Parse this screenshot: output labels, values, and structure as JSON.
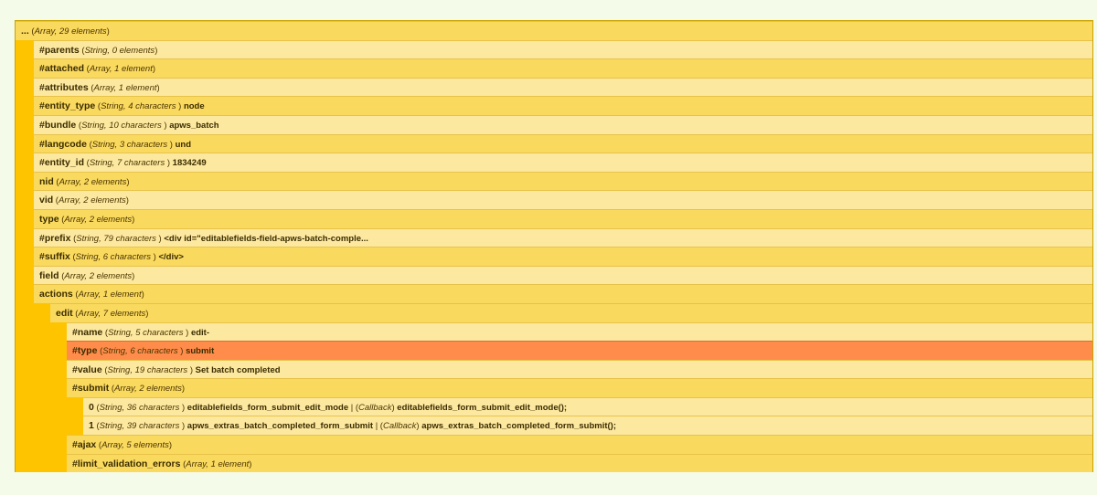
{
  "root": {
    "key": "...",
    "type": "Array",
    "size": "29 elements"
  },
  "rows": [
    {
      "key": "#parents",
      "type": "String",
      "size": "0 elements",
      "isArray": true,
      "depth": 1,
      "shade": "light"
    },
    {
      "key": "#attached",
      "type": "Array",
      "size": "1 element",
      "isArray": true,
      "depth": 1,
      "shade": "dark"
    },
    {
      "key": "#attributes",
      "type": "Array",
      "size": "1 element",
      "isArray": true,
      "depth": 1,
      "shade": "light"
    },
    {
      "key": "#entity_type",
      "type": "String",
      "size": "4 characters",
      "value": "node",
      "depth": 1,
      "shade": "dark"
    },
    {
      "key": "#bundle",
      "type": "String",
      "size": "10 characters",
      "value": "apws_batch",
      "depth": 1,
      "shade": "light"
    },
    {
      "key": "#langcode",
      "type": "String",
      "size": "3 characters",
      "value": "und",
      "depth": 1,
      "shade": "dark"
    },
    {
      "key": "#entity_id",
      "type": "String",
      "size": "7 characters",
      "value": "1834249",
      "depth": 1,
      "shade": "light"
    },
    {
      "key": "nid",
      "type": "Array",
      "size": "2 elements",
      "isArray": true,
      "depth": 1,
      "shade": "dark"
    },
    {
      "key": "vid",
      "type": "Array",
      "size": "2 elements",
      "isArray": true,
      "depth": 1,
      "shade": "light"
    },
    {
      "key": "type",
      "type": "Array",
      "size": "2 elements",
      "isArray": true,
      "depth": 1,
      "shade": "dark"
    },
    {
      "key": "#prefix",
      "type": "String",
      "size": "79 characters",
      "value": "<div id=\"editablefields-field-apws-batch-comple...",
      "depth": 1,
      "shade": "light"
    },
    {
      "key": "#suffix",
      "type": "String",
      "size": "6 characters",
      "value": "</div>",
      "depth": 1,
      "shade": "dark"
    },
    {
      "key": "field",
      "type": "Array",
      "size": "2 elements",
      "isArray": true,
      "depth": 1,
      "shade": "light"
    },
    {
      "key": "actions",
      "type": "Array",
      "size": "1 element",
      "isArray": true,
      "depth": 1,
      "shade": "dark"
    },
    {
      "key": "edit",
      "type": "Array",
      "size": "7 elements",
      "isArray": true,
      "depth": 2,
      "shade": "dark"
    },
    {
      "key": "#name",
      "type": "String",
      "size": "5 characters",
      "value": "edit-",
      "depth": 3,
      "shade": "light"
    },
    {
      "key": "#type",
      "type": "String",
      "size": "6 characters",
      "value": "submit",
      "depth": 3,
      "shade": "highlight"
    },
    {
      "key": "#value",
      "type": "String",
      "size": "19 characters",
      "value": "Set batch completed",
      "depth": 3,
      "shade": "light"
    },
    {
      "key": "#submit",
      "type": "Array",
      "size": "2 elements",
      "isArray": true,
      "depth": 3,
      "shade": "dark"
    },
    {
      "key": "0",
      "type": "String",
      "size": "36 characters",
      "value": "editablefields_form_submit_edit_mode",
      "callback_label": "Callback",
      "callback": "editablefields_form_submit_edit_mode();",
      "depth": 4,
      "shade": "light"
    },
    {
      "key": "1",
      "type": "String",
      "size": "39 characters",
      "value": "apws_extras_batch_completed_form_submit",
      "callback_label": "Callback",
      "callback": "apws_extras_batch_completed_form_submit();",
      "depth": 4,
      "shade": "light"
    },
    {
      "key": "#ajax",
      "type": "Array",
      "size": "5 elements",
      "isArray": true,
      "depth": 3,
      "shade": "dark"
    },
    {
      "key": "#limit_validation_errors",
      "type": "Array",
      "size": "1 element",
      "isArray": true,
      "depth": 3,
      "shade": "dark"
    }
  ]
}
